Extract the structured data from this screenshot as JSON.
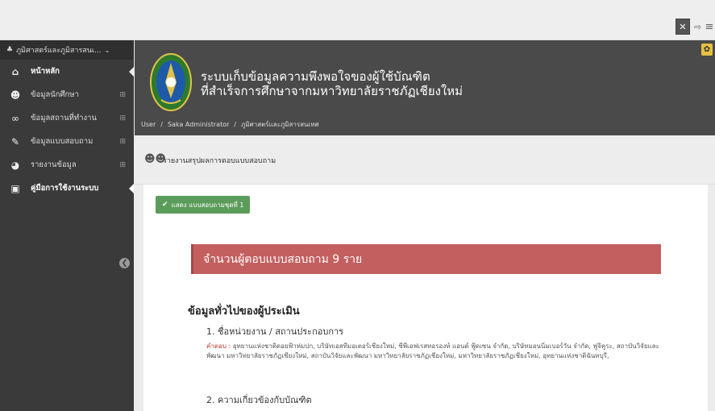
{
  "topbar": {
    "fullscreen_icon": "expand-icon",
    "logout_icon": "logout-icon",
    "menu_icon": "hamburger-icon"
  },
  "sidebar": {
    "header": "ภูมิศาสตร์และภูมิสารสนเ...",
    "items": [
      {
        "label": "หน้าหลัก",
        "icon": "home-icon"
      },
      {
        "label": "ข้อมูลนักศึกษา",
        "icon": "users-icon"
      },
      {
        "label": "ข้อมูลสถานที่ทำงาน",
        "icon": "link-icon"
      },
      {
        "label": "ข้อมูลแบบสอบถาม",
        "icon": "edit-icon"
      },
      {
        "label": "รายงานข้อมูล",
        "icon": "pie-chart-icon"
      },
      {
        "label": "คู่มือการใช้งานระบบ",
        "icon": "pdf-icon"
      }
    ]
  },
  "banner": {
    "title_line1": "ระบบเก็บข้อมูลความพึงพอใจของผู้ใช้บัณฑิต",
    "title_line2": "ที่สำเร็จการศึกษาจากมหาวิทยาลัยราชภัฏเชียงใหม่",
    "breadcrumb": [
      "User",
      "Saka Administrator",
      "ภูมิศาสตร์และภูมิสารสนเทศ"
    ]
  },
  "report": {
    "title": "รายงานสรุปผลการตอบแบบสอบถาม"
  },
  "content": {
    "show_button": "แสดง แบบสอบถามชุดที่ 1",
    "count_text": "จำนวนผู้ตอบแบบสอบถาม 9 ราย",
    "section_title": "ข้อมูลทั่วไปของผู้ประเมิน",
    "q1": "1. ชื่อหน่วยงาน / สถานประกอบการ",
    "answer_label": "คำตอบ :",
    "answer_text": "อุทยานแห่งชาติดอยฟ้าห่มปก, บริษัทเอสทีมอเตอร์เชียงใหม่, ซีพีเอฟเรสทอรองท์ แอนด์ ฟู้ดเซน จำกัด, บริษัทมอนนิ่มเบอร์วัน จำกัด, ฟูจิคูระ, สถาบันวิจัยและพัฒนา มหาวิทยาลัยราชภัฏเชียงใหม่, สถาบันวิจัยและพัฒนา มหาวิทยาลัยราชภัฏเชียงใหม่, มหาวิทยาลัยราชภัฏเชียงใหม่, อุทยานแห่งชาติฉันทบุรี,",
    "q2": "2. ความเกี่ยวข้องกับบัณฑิต"
  }
}
